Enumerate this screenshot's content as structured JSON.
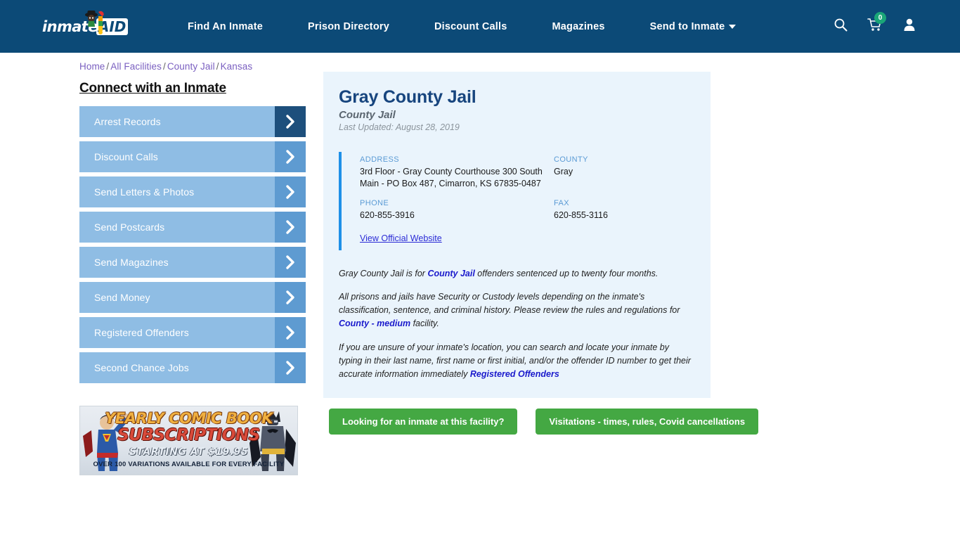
{
  "navbar": {
    "logo": {
      "name": "inmate",
      "badge": "AID",
      "icon": "mascot-icon"
    },
    "links": [
      {
        "label": "Find An Inmate"
      },
      {
        "label": "Prison Directory"
      },
      {
        "label": "Discount Calls"
      },
      {
        "label": "Magazines"
      },
      {
        "label": "Send to Inmate",
        "has_caret": true
      }
    ],
    "icons": {
      "search": "search-icon",
      "cart": "cart-icon",
      "cart_count": "0",
      "account": "user-icon"
    },
    "colors": {
      "background": "#0c4a77",
      "badge": "#1aa678"
    }
  },
  "breadcrumb": {
    "items": [
      "Home",
      "All Facilities",
      "County Jail",
      "Kansas"
    ],
    "separator": "/"
  },
  "sidebar": {
    "heading": "Connect with an Inmate",
    "items": [
      {
        "label": "Arrest Records",
        "active": true
      },
      {
        "label": "Discount Calls",
        "active": false
      },
      {
        "label": "Send Letters & Photos",
        "active": false
      },
      {
        "label": "Send Postcards",
        "active": false
      },
      {
        "label": "Send Magazines",
        "active": false
      },
      {
        "label": "Send Money",
        "active": false
      },
      {
        "label": "Registered Offenders",
        "active": false
      },
      {
        "label": "Second Chance Jobs",
        "active": false
      }
    ],
    "ad": {
      "line1": "YEARLY COMIC BOOK",
      "line2": "SUBSCRIPTIONS",
      "line3": "STARTING AT $19.95",
      "line4": "OVER 100 VARIATIONS AVAILABLE FOR EVERY FACILITY"
    }
  },
  "facility": {
    "title": "Gray County Jail",
    "subtitle": "County Jail",
    "last_updated": "Last Updated: August 28, 2019",
    "fields": {
      "address_label": "ADDRESS",
      "address_value": "3rd Floor - Gray County Courthouse 300 South Main - PO Box 487, Cimarron, KS 67835-0487",
      "county_label": "COUNTY",
      "county_value": "Gray",
      "phone_label": "PHONE",
      "phone_value": "620-855-3916",
      "fax_label": "FAX",
      "fax_value": "620-855-3116"
    },
    "official_website_link": "View Official Website",
    "paragraphs": {
      "p1_a": "Gray County Jail is for ",
      "p1_link": "County Jail",
      "p1_b": " offenders sentenced up to twenty four months.",
      "p2_a": "All prisons and jails have Security or Custody levels depending on the inmate's classification, sentence, and criminal history. Please review the rules and regulations for ",
      "p2_link": "County - medium",
      "p2_b": " facility.",
      "p3_a": "If you are unsure of your inmate's location, you can search and locate your inmate by typing in their last name, first name or first initial, and/or the offender ID number to get their accurate information immediately ",
      "p3_link": "Registered Offenders"
    },
    "cta": {
      "primary": "Looking for an inmate at this facility?",
      "secondary": "Visitations - times, rules, Covid cancellations"
    },
    "colors": {
      "card_bg": "#eaf4fc",
      "accent_bar": "#1e90e8",
      "cta_green": "#44a843",
      "title": "#17457e"
    }
  }
}
